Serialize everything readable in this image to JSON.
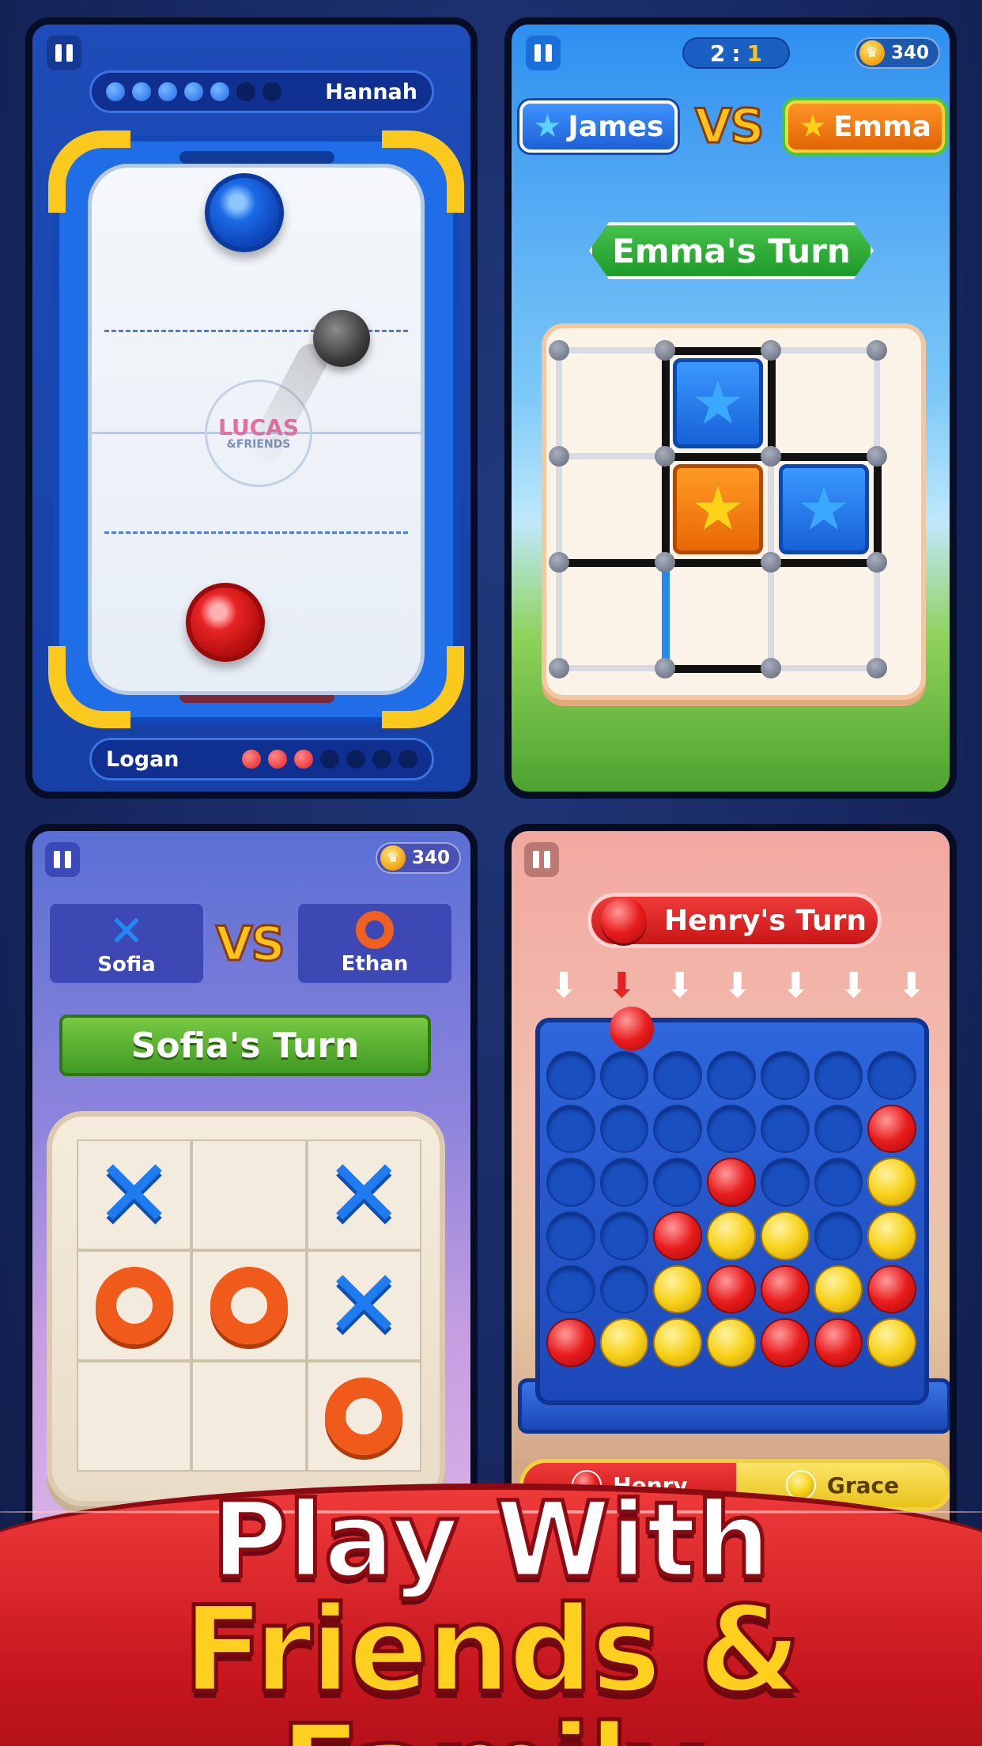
{
  "air_hockey": {
    "top_player": "Hannah",
    "top_score": {
      "filled": 5,
      "total": 7
    },
    "bottom_player": "Logan",
    "bottom_score": {
      "filled": 3,
      "total": 7
    },
    "center_logo_main": "LUCAS",
    "center_logo_sub": "&FRIENDS"
  },
  "dots_boxes": {
    "score_left": "2",
    "score_sep": ":",
    "score_right": "1",
    "coins": "340",
    "player1": "James",
    "player2": "Emma",
    "vs": "VS",
    "turn": "Emma's Turn"
  },
  "tic_tac_toe": {
    "coins": "340",
    "player_x": "Sofia",
    "player_o": "Ethan",
    "x_symbol": "✕",
    "vs": "VS",
    "turn": "Sofia's Turn",
    "board": [
      "X",
      "",
      "X",
      "O",
      "O",
      "X",
      "",
      "",
      "O"
    ]
  },
  "connect_four": {
    "turn": "Henry's Turn",
    "active_column": 1,
    "grid": [
      [
        "",
        "",
        "",
        "",
        "",
        "",
        ""
      ],
      [
        "",
        "",
        "",
        "",
        "",
        "",
        "R"
      ],
      [
        "",
        "",
        "",
        "R",
        "",
        "",
        "Y"
      ],
      [
        "",
        "",
        "R",
        "Y",
        "Y",
        "",
        "Y"
      ],
      [
        "",
        "",
        "Y",
        "R",
        "R",
        "Y",
        "R"
      ],
      [
        "R",
        "Y",
        "Y",
        "Y",
        "R",
        "R",
        "Y"
      ]
    ],
    "player1": "Henry",
    "player2": "Grace"
  },
  "headline": {
    "line1": "Play With",
    "line2": "Friends & Family"
  },
  "colors": {
    "red_player": "#e41f1f",
    "blue_player": "#1e6ae8",
    "yellow_disc": "#f7d21b",
    "accent_gold": "#ffcf1f"
  }
}
